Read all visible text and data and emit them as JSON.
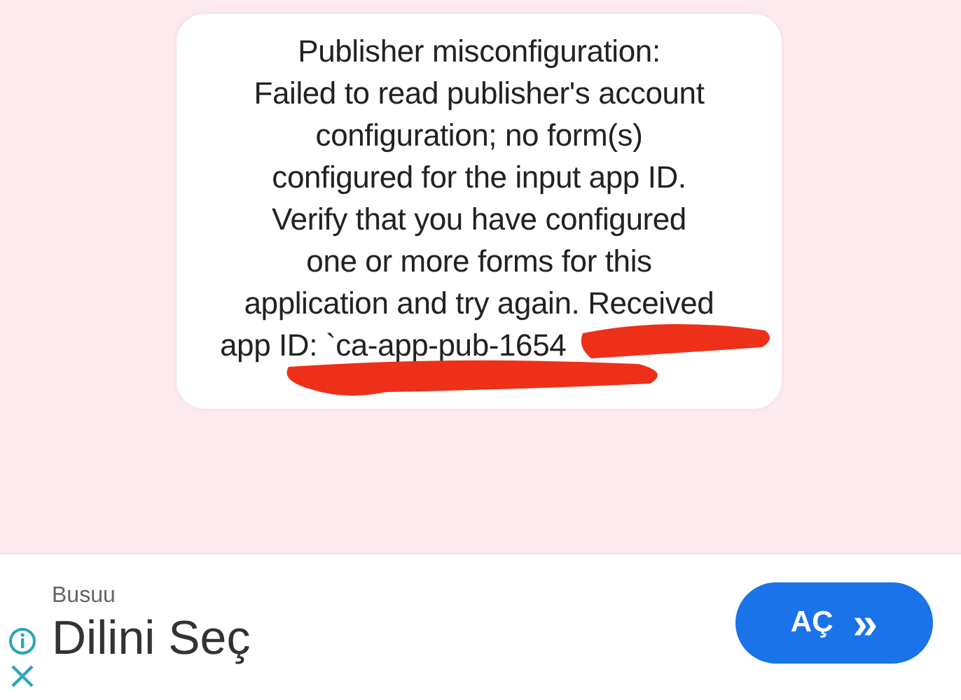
{
  "dialog": {
    "message_lines": [
      "Publisher misconfiguration:",
      "Failed to read publisher's account",
      "configuration; no form(s)",
      "configured for the input app ID.",
      "Verify that you have configured",
      "one or more forms for this",
      "application and try again. Received",
      "app ID: `ca-app-pub-1654"
    ]
  },
  "ad": {
    "advertiser": "Busuu",
    "headline": "Dilini Seç",
    "button": {
      "label": "AÇ",
      "icon": "»"
    }
  }
}
